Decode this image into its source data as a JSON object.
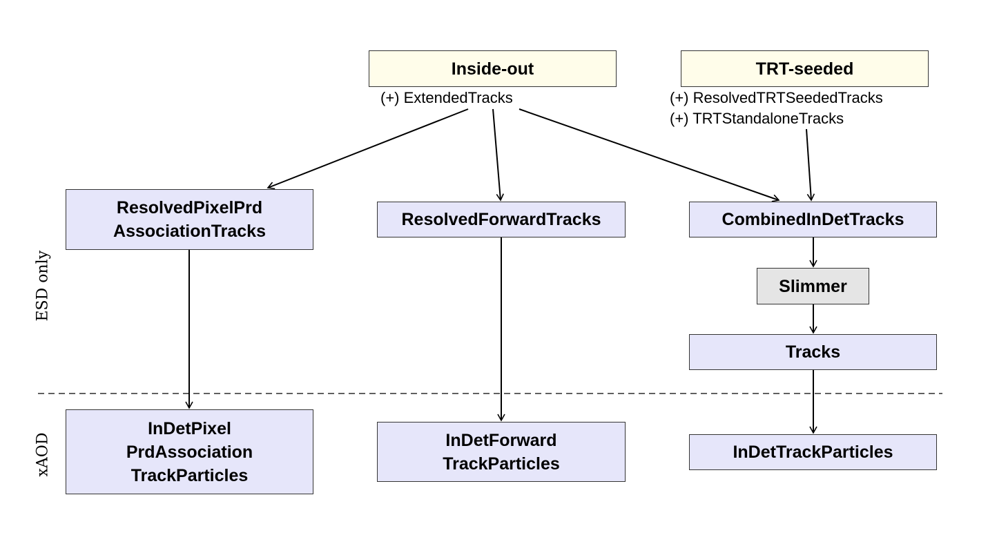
{
  "sections": {
    "esd": "ESD only",
    "xaod": "xAOD"
  },
  "sources": {
    "inside_out": {
      "title": "Inside-out",
      "outputs": [
        "(+) ExtendedTracks"
      ]
    },
    "trt_seeded": {
      "title": "TRT-seeded",
      "outputs": [
        "(+) ResolvedTRTSeededTracks",
        "(+) TRTStandaloneTracks"
      ]
    }
  },
  "esd_nodes": {
    "resolved_pixel": "ResolvedPixelPrd\nAssociationTracks",
    "resolved_forward": "ResolvedForwardTracks",
    "combined": "CombinedInDetTracks",
    "slimmer": "Slimmer",
    "tracks": "Tracks"
  },
  "xaod_nodes": {
    "pixel_particles": "InDetPixel\nPrdAssociation\nTrackParticles",
    "forward_particles": "InDetForward\nTrackParticles",
    "track_particles": "InDetTrackParticles"
  },
  "colors": {
    "source": "#fffdea",
    "container": "#e6e6fa",
    "algorithm": "#e5e5e5"
  }
}
